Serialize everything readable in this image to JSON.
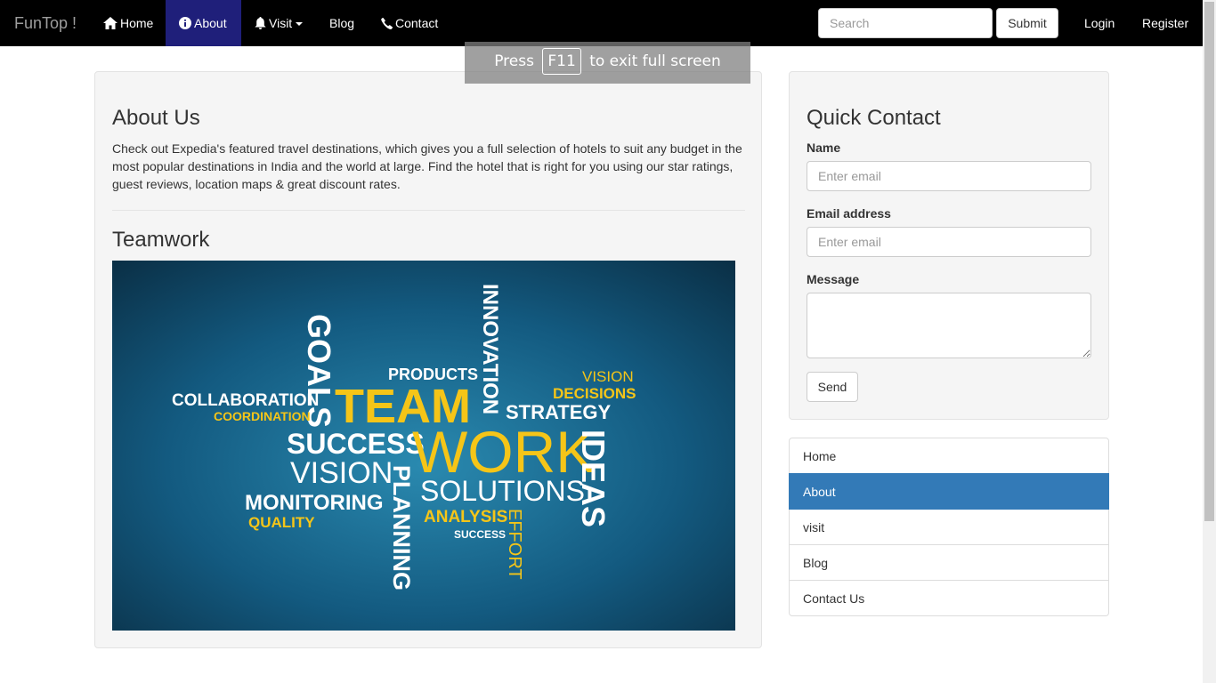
{
  "navbar": {
    "brand": "FunTop !",
    "items": [
      {
        "label": "Home",
        "icon": "home-icon"
      },
      {
        "label": "About",
        "icon": "info-icon",
        "active": true
      },
      {
        "label": "Visit",
        "icon": "bell-icon",
        "dropdown": true
      },
      {
        "label": "Blog"
      },
      {
        "label": "Contact",
        "icon": "phone-icon"
      }
    ],
    "search_placeholder": "Search",
    "submit_label": "Submit",
    "login_label": "Login",
    "register_label": "Register"
  },
  "fullscreen_notice": {
    "prefix": "Press",
    "key": "F11",
    "suffix": "to exit full screen"
  },
  "main": {
    "about_title": "About Us",
    "about_text": "Check out Expedia's featured travel destinations, which gives you a full selection of hotels to suit any budget in the most popular destinations in India and the world at large. Find the hotel that is right for you using our star ratings, guest reviews, location maps & great discount rates.",
    "teamwork_title": "Teamwork",
    "image_words": {
      "innovation": "INNOVATION",
      "goals": "GOALS",
      "products": "PRODUCTS",
      "vision_top": "VISION",
      "decisions": "DECISIONS",
      "collaboration": "COLLABORATION",
      "team": "TEAM",
      "coordination": "COORDINATION",
      "strategy": "STRATEGY",
      "success": "SUCCESS",
      "work": "WORK",
      "ideas": "IDEAS",
      "vision": "VISION",
      "planning": "PLANNING",
      "solutions": "SOLUTIONS",
      "monitoring": "MONITORING",
      "quality": "QUALITY",
      "analysis": "ANALYSIS",
      "effort": "EFFORT",
      "success_small": "SUCCESS"
    },
    "image_colors": {
      "bg_light": "#2a8ab0",
      "bg_dark": "#0a2e44",
      "yellow": "#f5c518",
      "white": "#ffffff"
    }
  },
  "quick_contact": {
    "title": "Quick Contact",
    "name_label": "Name",
    "name_placeholder": "Enter email",
    "email_label": "Email address",
    "email_placeholder": "Enter email",
    "message_label": "Message",
    "send_label": "Send"
  },
  "sidebar_links": [
    {
      "label": "Home"
    },
    {
      "label": "About",
      "active": true
    },
    {
      "label": "visit"
    },
    {
      "label": "Blog"
    },
    {
      "label": "Contact Us"
    }
  ],
  "colors": {
    "navbar_bg": "#000000",
    "active_nav": "#1f1f7a",
    "list_active": "#337ab7"
  }
}
